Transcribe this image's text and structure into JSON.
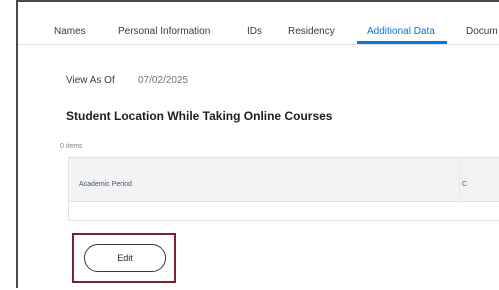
{
  "tabs": [
    {
      "label": "Names"
    },
    {
      "label": "Personal Information"
    },
    {
      "label": "IDs"
    },
    {
      "label": "Residency"
    },
    {
      "label": "Additional Data",
      "active": true
    },
    {
      "label": "Docum"
    }
  ],
  "view_as_of": {
    "label": "View As Of",
    "value": "07/02/2025"
  },
  "section": {
    "title": "Student Location While Taking Online Courses",
    "items_count": "0 items"
  },
  "table": {
    "columns": [
      "Academic Period",
      "C"
    ]
  },
  "actions": {
    "edit_label": "Edit"
  },
  "colors": {
    "active_tab": "#0875e1",
    "highlight_border": "#7b2230"
  }
}
